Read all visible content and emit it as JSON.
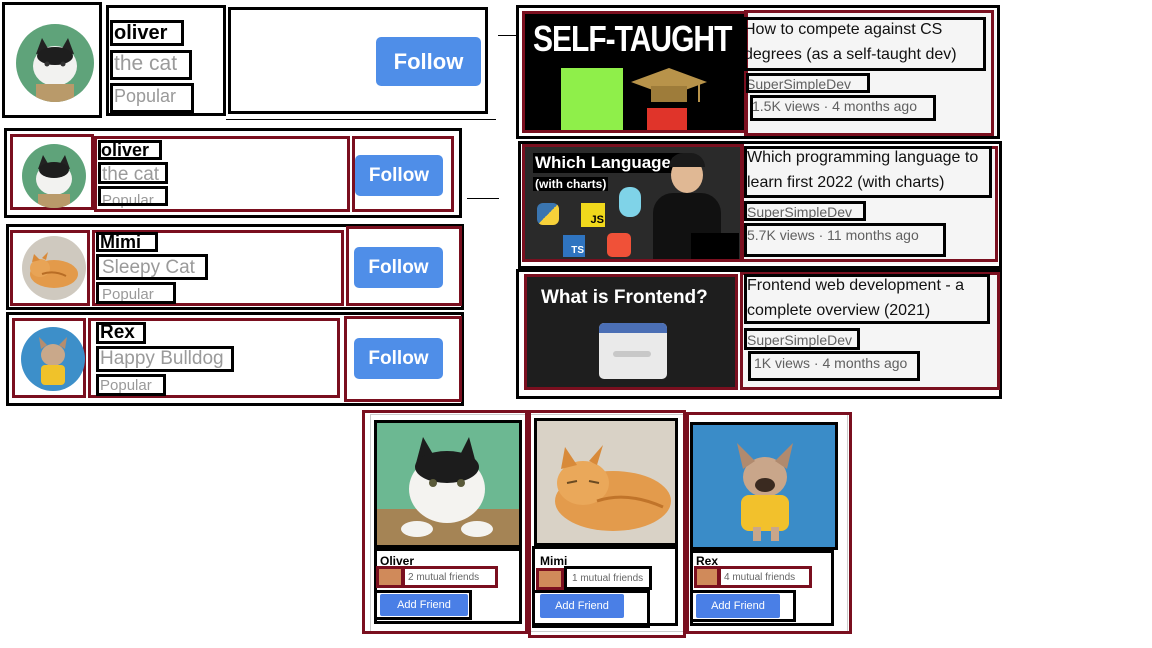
{
  "suggestions": [
    {
      "name": "oliver",
      "subtitle": "the cat",
      "tag": "Popular",
      "button": "Follow"
    },
    {
      "name": "oliver",
      "subtitle": "the cat",
      "tag": "Popular",
      "button": "Follow"
    },
    {
      "name": "Mimi",
      "subtitle": "Sleepy Cat",
      "tag": "Popular",
      "button": "Follow"
    },
    {
      "name": "Rex",
      "subtitle": "Happy Bulldog",
      "tag": "Popular",
      "button": "Follow"
    }
  ],
  "videos": [
    {
      "thumb_text": "SELF-TAUGHT",
      "title": "How to compete against CS degrees (as a self-taught dev)",
      "channel": "SuperSimpleDev",
      "views": "1.5K views",
      "age": "4 months ago"
    },
    {
      "thumb_text": "Which Language?",
      "thumb_sub": "(with charts)",
      "thumb_badges": [
        "JS",
        "TS"
      ],
      "title": "Which programming language to learn first 2022 (with charts)",
      "channel": "SuperSimpleDev",
      "views": "5.7K views",
      "age": "11 months ago"
    },
    {
      "thumb_text": "What is Frontend?",
      "title": "Frontend web development - a complete overview (2021)",
      "channel": "SuperSimpleDev",
      "views": "1K views",
      "age": "4 months ago"
    }
  ],
  "friends": [
    {
      "name": "Oliver",
      "mutual": "2 mutual friends",
      "button": "Add Friend"
    },
    {
      "name": "Mimi",
      "mutual": "1 mutual friends",
      "button": "Add Friend"
    },
    {
      "name": "Rex",
      "mutual": "4 mutual friends",
      "button": "Add Friend"
    }
  ],
  "colors": {
    "follow_blue": "#4f8ee8",
    "box_black": "#000000",
    "box_maroon": "#7a0f1f"
  }
}
